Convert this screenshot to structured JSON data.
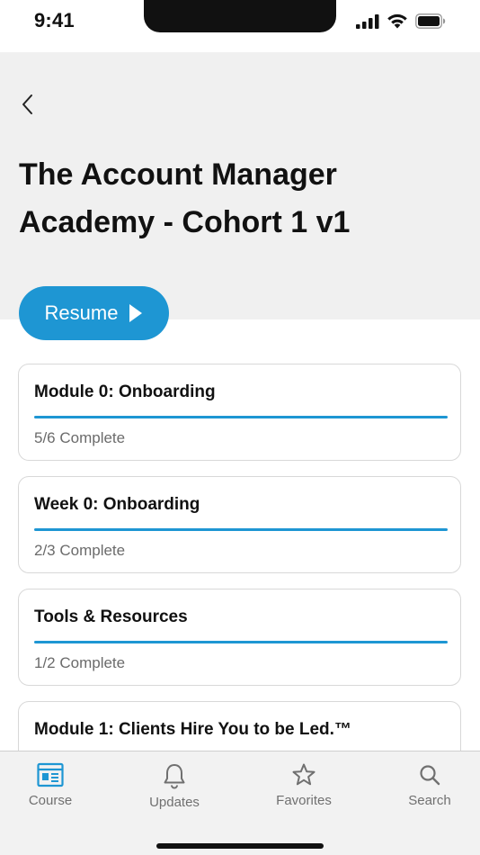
{
  "status_bar": {
    "time": "9:41"
  },
  "header": {
    "title": "The Account Manager Academy - Cohort 1 v1",
    "resume_label": "Resume"
  },
  "modules": [
    {
      "title": "Module 0: Onboarding",
      "status": "5/6 Complete",
      "progress": 1.0
    },
    {
      "title": "Week 0: Onboarding",
      "status": "2/3 Complete",
      "progress": 1.0
    },
    {
      "title": "Tools & Resources",
      "status": "1/2 Complete",
      "progress": 1.0
    },
    {
      "title": "Module 1: Clients Hire You to be Led.™",
      "status": "",
      "progress": 1.0
    }
  ],
  "nav": {
    "items": [
      {
        "label": "Course",
        "icon": "course-icon",
        "active": true
      },
      {
        "label": "Updates",
        "icon": "bell-icon",
        "active": false
      },
      {
        "label": "Favorites",
        "icon": "star-icon",
        "active": false
      },
      {
        "label": "Search",
        "icon": "search-icon",
        "active": false
      }
    ]
  },
  "colors": {
    "accent": "#1e96d3",
    "header_bg": "#f0f0f0",
    "nav_bg": "#f2f2f2",
    "muted_text": "#6b6b6b"
  }
}
